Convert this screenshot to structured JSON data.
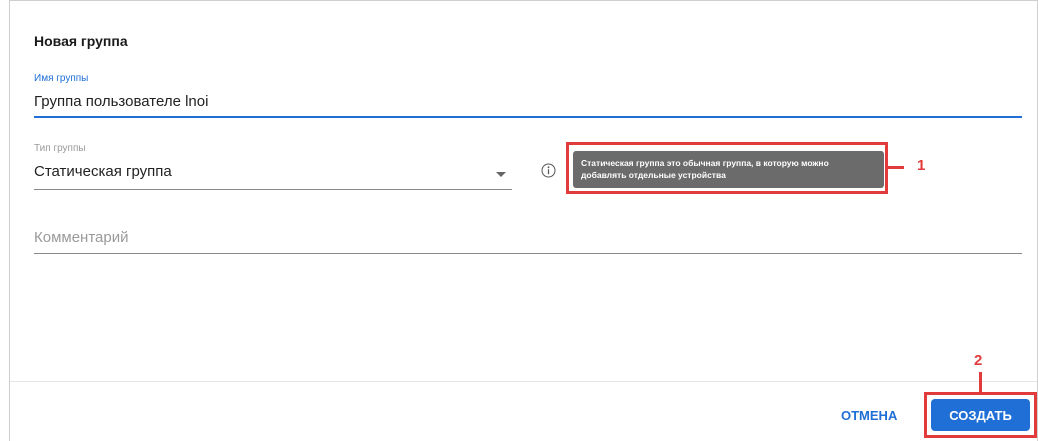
{
  "dialog": {
    "title": "Новая группа"
  },
  "fields": {
    "group_name": {
      "label": "Имя группы",
      "value": "Группа пользователе lnoi"
    },
    "group_type": {
      "label": "Тип группы",
      "value": "Статическая группа"
    },
    "comment": {
      "placeholder": "Комментарий",
      "value": ""
    }
  },
  "tooltip": {
    "text_line1": "Статическая группа это обычная группа, в которую можно",
    "text_line2": "добавлять отдельные устройства"
  },
  "annotations": {
    "marker_1": "1",
    "marker_2": "2",
    "color": "#e23b3b"
  },
  "footer": {
    "cancel_label": "ОТМЕНА",
    "create_label": "СОЗДАТЬ"
  },
  "colors": {
    "accent": "#1f6fd6",
    "tooltip_bg": "#6b6b6b"
  },
  "icons": {
    "info": "info-icon",
    "dropdown": "chevron-down-icon"
  }
}
